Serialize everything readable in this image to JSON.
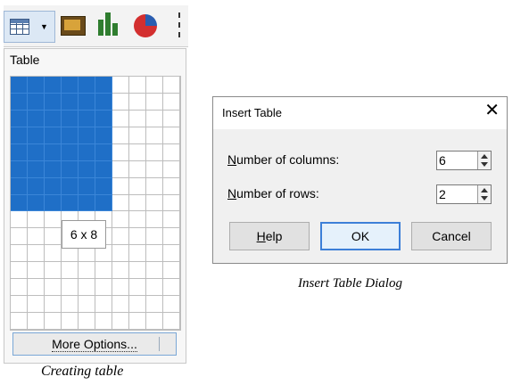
{
  "picker": {
    "title": "Table",
    "columns_total": 10,
    "rows_total": 15,
    "selected_columns": 6,
    "selected_rows": 8,
    "size_label": "6 x 8",
    "more_options_label": "More Options..."
  },
  "toolbar": {
    "icons": [
      "insert-table-icon",
      "insert-image-icon",
      "insert-chart-icon",
      "insert-pie-chart-icon"
    ]
  },
  "dialog": {
    "title": "Insert Table",
    "close_glyph": "✕",
    "columns_label_accel": "N",
    "columns_label_rest": "umber of columns:",
    "columns_value": "6",
    "rows_label_accel": "N",
    "rows_label_rest": "umber of rows:",
    "rows_value": "2",
    "help_label_accel": "H",
    "help_label_rest": "elp",
    "ok_label": "OK",
    "cancel_label": "Cancel"
  },
  "captions": {
    "left": "Creating table",
    "right": "Insert Table Dialog"
  },
  "colors": {
    "selected_cell": "#1f6fc7",
    "default_button_border": "#3c7fd8"
  }
}
